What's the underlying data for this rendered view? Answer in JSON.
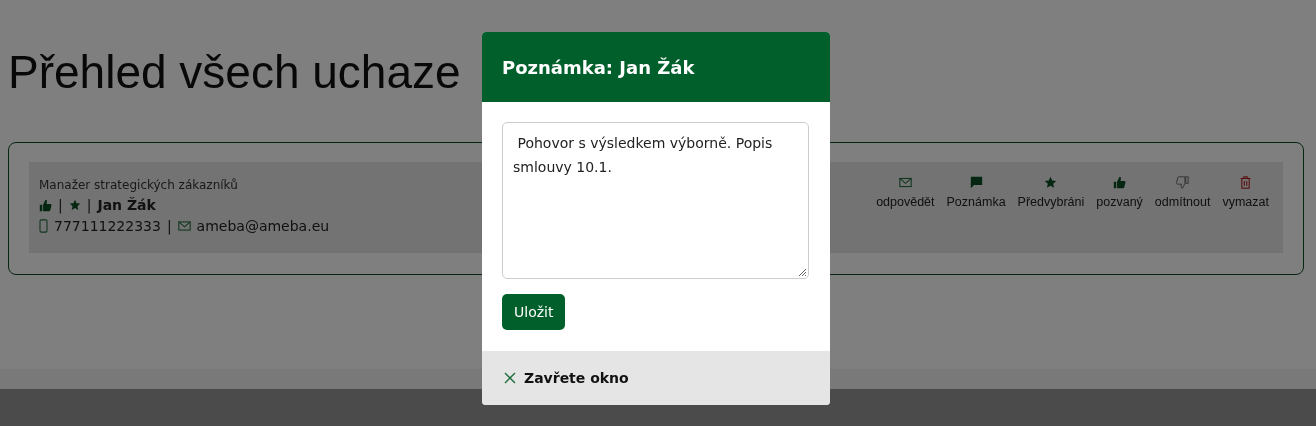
{
  "page": {
    "title": "Přehled všech uchaze"
  },
  "candidate": {
    "separator": "|",
    "position": "Manažer strategických zákazníků",
    "name": "Jan Žák",
    "phone": "777111222333",
    "email": "ameba@ameba.eu",
    "invited": true,
    "preselected": true
  },
  "actions": [
    {
      "kind": "reply",
      "label": "odpovědět"
    },
    {
      "kind": "note",
      "label": "Poznámka"
    },
    {
      "kind": "preselect",
      "label": "Předvybráni"
    },
    {
      "kind": "invite",
      "label": "pozvaný"
    },
    {
      "kind": "reject",
      "label": "odmítnout"
    },
    {
      "kind": "delete",
      "label": "vymazat"
    }
  ],
  "modal": {
    "title": "Poznámka: Jan Žák",
    "note": " Pohovor s výsledkem výborně. Popis smlouvy 10.1.",
    "save": "Uložit",
    "close": "Zavřete okno"
  }
}
